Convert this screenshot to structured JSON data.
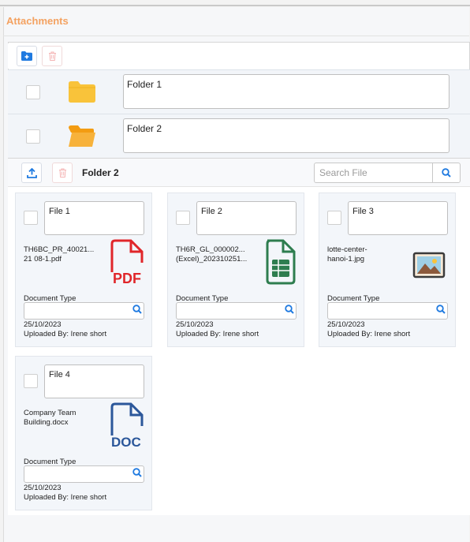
{
  "panel": {
    "title": "Attachments"
  },
  "folders": [
    {
      "name": "Folder 1",
      "icon": "folder-icon"
    },
    {
      "name": "Folder 2",
      "icon": "folder-open-icon"
    }
  ],
  "toolbar": {
    "add_folder_icon": "add-folder-icon",
    "delete_icon": "trash-icon",
    "upload_icon": "upload-icon",
    "current_folder": "Folder 2"
  },
  "search": {
    "placeholder": "Search File",
    "value": ""
  },
  "files": [
    {
      "name": "File 1",
      "filename": "TH6BC_PR_40021...\n21 08-1.pdf",
      "type": "pdf-icon",
      "doc_type_label": "Document Type",
      "doc_type_value": "",
      "date": "25/10/2023",
      "uploaded_by": "Uploaded By: Irene short"
    },
    {
      "name": "File 2",
      "filename": "TH6R_GL_000002...\n(Excel)_202310251...",
      "type": "sheet-icon",
      "doc_type_label": "Document Type",
      "doc_type_value": "",
      "date": "25/10/2023",
      "uploaded_by": "Uploaded By: Irene short"
    },
    {
      "name": "File 3",
      "filename": "lotte-center-\nhanoi-1.jpg",
      "type": "image-icon",
      "doc_type_label": "Document Type",
      "doc_type_value": "",
      "date": "25/10/2023",
      "uploaded_by": "Uploaded By: Irene short"
    },
    {
      "name": "File 4",
      "filename": "Company Team\nBuilding.docx",
      "type": "doc-icon",
      "doc_type_label": "Document Type",
      "doc_type_value": "",
      "date": "25/10/2023",
      "uploaded_by": "Uploaded By: Irene short"
    }
  ],
  "colors": {
    "accent": "#f4a261",
    "primary": "#1f7ae0",
    "pdf": "#e0262a",
    "sheet": "#2e7d4f",
    "doc": "#2b579a",
    "folder": "#f9c33a"
  }
}
